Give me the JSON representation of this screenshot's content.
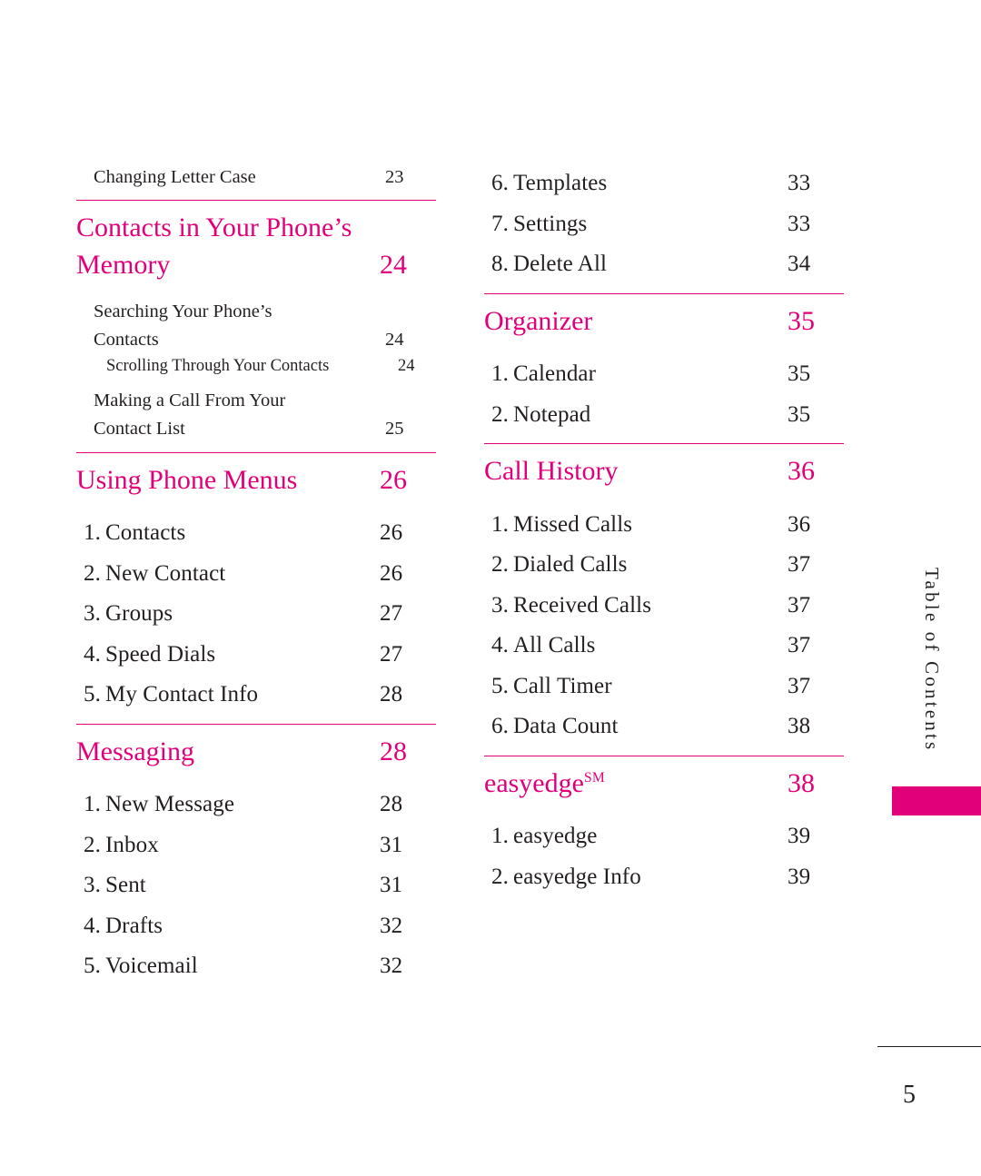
{
  "side_tab": {
    "label": "Table of Contents"
  },
  "folio": {
    "page_number": "5"
  },
  "left_column": {
    "top_entry": {
      "label": "Changing Letter Case",
      "page": "23"
    },
    "chapter1": {
      "line1": "Contacts in Your Phone’s",
      "line2": "Memory",
      "page": "24"
    },
    "chapter1_entries": [
      {
        "label_line1": "Searching Your Phone’s",
        "label_line2": "Contacts",
        "page": "24"
      },
      {
        "label": "Scrolling Through Your Contacts",
        "page": "24"
      },
      {
        "label_line1": "Making a Call From Your",
        "label_line2": "Contact List",
        "page": "25"
      }
    ],
    "chapter2": {
      "label": "Using Phone Menus",
      "page": "26"
    },
    "chapter2_entries": [
      {
        "num": "1.",
        "label": "Contacts",
        "page": "26"
      },
      {
        "num": "2.",
        "label": "New Contact",
        "page": "26"
      },
      {
        "num": "3.",
        "label": "Groups",
        "page": "27"
      },
      {
        "num": "4.",
        "label": "Speed Dials",
        "page": "27"
      },
      {
        "num": "5.",
        "label": "My Contact Info",
        "page": "28"
      }
    ],
    "chapter3": {
      "label": "Messaging",
      "page": "28"
    },
    "chapter3_entries": [
      {
        "num": "1.",
        "label": "New Message",
        "page": "28"
      },
      {
        "num": "2.",
        "label": "Inbox",
        "page": "31"
      },
      {
        "num": "3.",
        "label": "Sent",
        "page": "31"
      },
      {
        "num": "4.",
        "label": "Drafts",
        "page": "32"
      },
      {
        "num": "5.",
        "label": "Voicemail",
        "page": "32"
      }
    ]
  },
  "right_column": {
    "top_entries": [
      {
        "num": "6.",
        "label": "Templates",
        "page": "33"
      },
      {
        "num": "7.",
        "label": "Settings",
        "page": "33"
      },
      {
        "num": "8.",
        "label": "Delete All",
        "page": "34"
      }
    ],
    "chapter4": {
      "label": "Organizer",
      "page": "35"
    },
    "chapter4_entries": [
      {
        "num": "1.",
        "label": "Calendar",
        "page": "35"
      },
      {
        "num": "2.",
        "label": "Notepad",
        "page": "35"
      }
    ],
    "chapter5": {
      "label": "Call History",
      "page": "36"
    },
    "chapter5_entries": [
      {
        "num": "1.",
        "label": "Missed Calls",
        "page": "36"
      },
      {
        "num": "2.",
        "label": "Dialed Calls",
        "page": "37"
      },
      {
        "num": "3.",
        "label": "Received Calls",
        "page": "37"
      },
      {
        "num": "4.",
        "label": "All Calls",
        "page": "37"
      },
      {
        "num": "5.",
        "label": "Call Timer",
        "page": "37"
      },
      {
        "num": "6.",
        "label": "Data Count",
        "page": "38"
      }
    ],
    "chapter6": {
      "label": "easyedge",
      "superscript": "SM",
      "page": "38"
    },
    "chapter6_entries": [
      {
        "num": "1.",
        "label": "easyedge",
        "page": "39"
      },
      {
        "num": "2.",
        "label": "easyedge Info",
        "page": "39"
      }
    ]
  },
  "colors": {
    "accent": "#e2007a",
    "text": "#231f20"
  }
}
